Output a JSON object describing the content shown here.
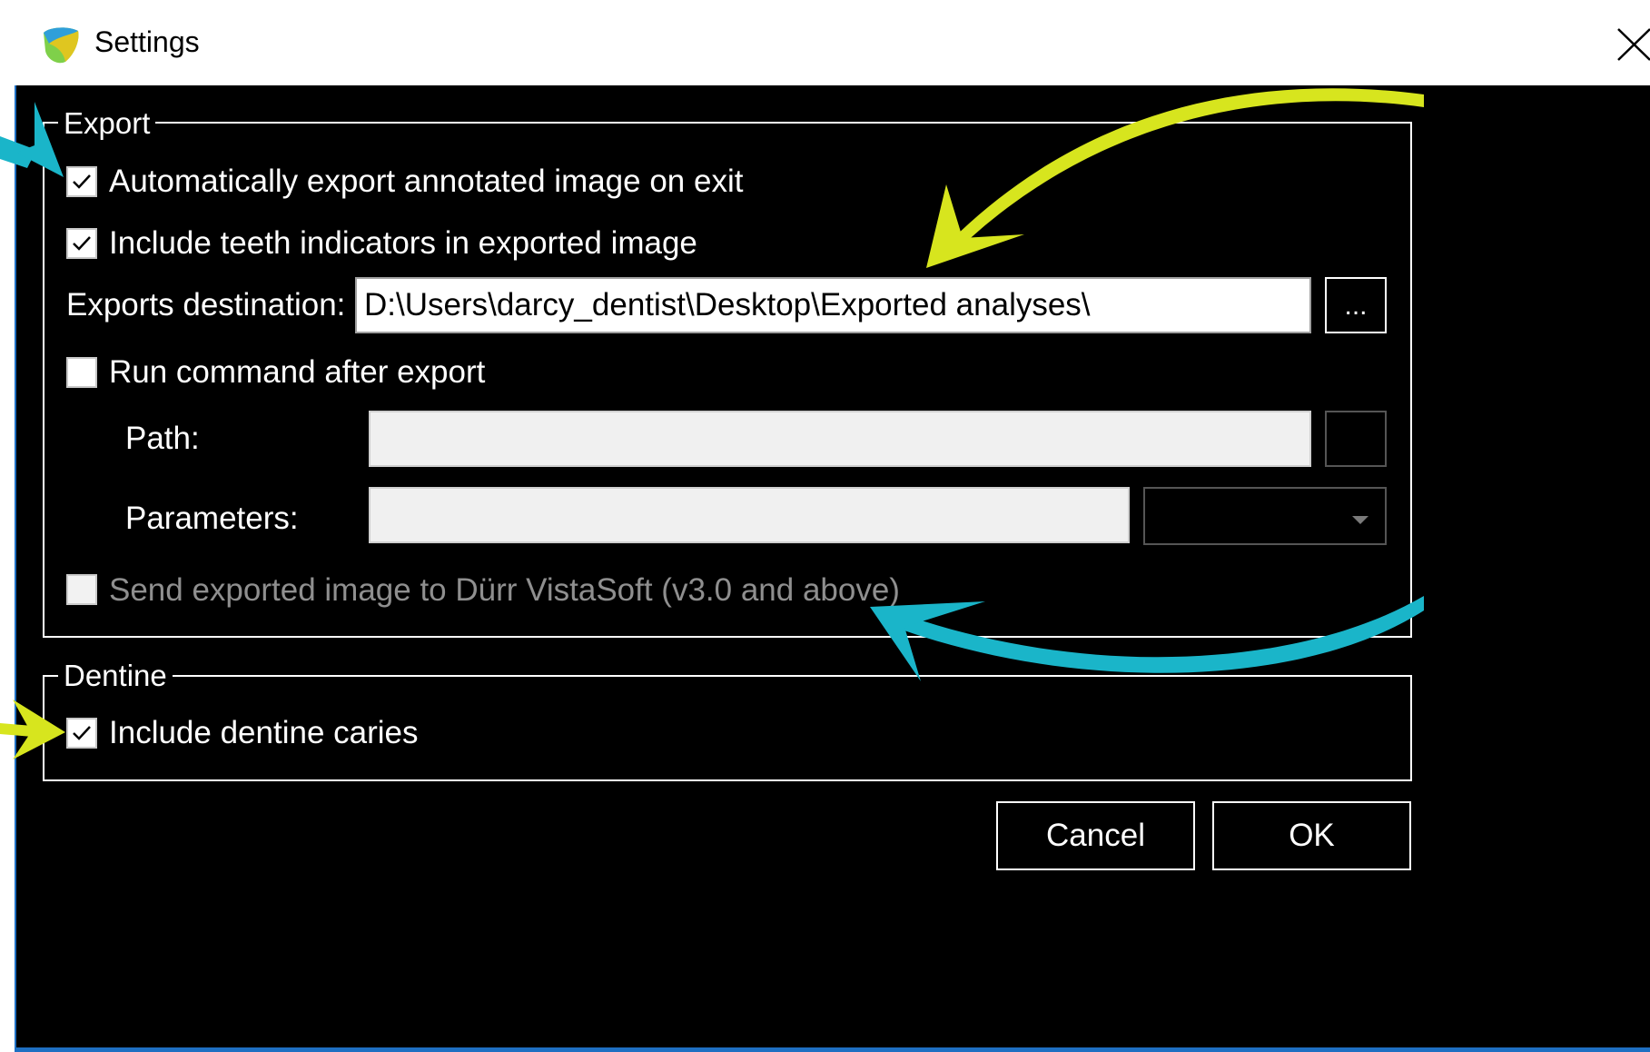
{
  "window": {
    "title": "Settings",
    "icons": {
      "app": "app-logo-icon",
      "close": "close-icon"
    }
  },
  "export_group": {
    "label": "Export",
    "auto_export": {
      "label": "Automatically export annotated image on exit",
      "checked": true
    },
    "include_teeth": {
      "label": "Include teeth indicators in exported image",
      "checked": true
    },
    "destination": {
      "label": "Exports destination:",
      "value": "D:\\Users\\darcy_dentist\\Desktop\\Exported analyses\\",
      "browse_label": "..."
    },
    "run_command": {
      "label": "Run command after export",
      "checked": false
    },
    "path": {
      "label": "Path:",
      "value": ""
    },
    "parameters": {
      "label": "Parameters:",
      "value": "",
      "dropdown_value": ""
    },
    "send_vistasoft": {
      "label": "Send exported image to Dürr VistaSoft (v3.0 and above)",
      "checked": false,
      "enabled": false
    }
  },
  "dentine_group": {
    "label": "Dentine",
    "include_dentine": {
      "label": "Include dentine caries",
      "checked": true
    }
  },
  "buttons": {
    "cancel": "Cancel",
    "ok": "OK"
  },
  "colors": {
    "background": "#000000",
    "foreground": "#ffffff",
    "annotation_yellow": "#d7e51e",
    "annotation_teal": "#1ab5c9"
  }
}
